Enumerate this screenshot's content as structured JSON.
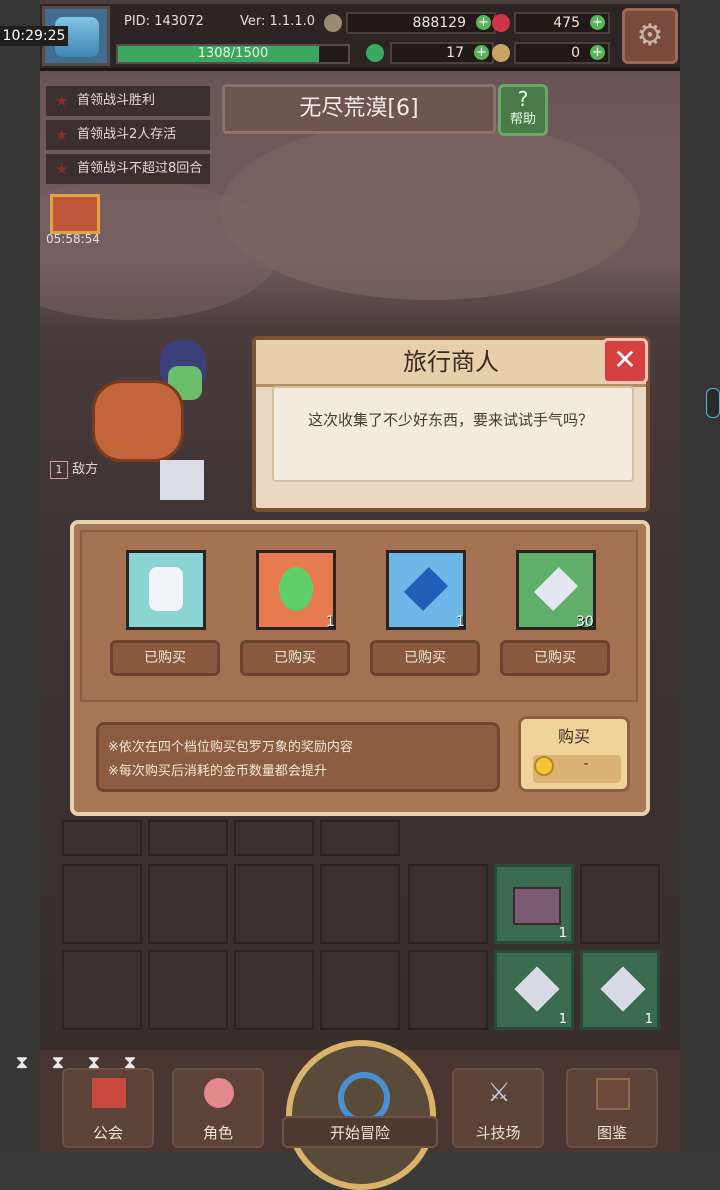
{
  "clock": "10:29:25",
  "player": {
    "pid_label": "PID: 143072",
    "version_label": "Ver: 1.1.1.0",
    "exp": "1308/1500",
    "exp_fraction": 0.872
  },
  "resources": {
    "gold": "888129",
    "gems": "475",
    "clover": "17",
    "key": "0"
  },
  "quests": [
    "首领战斗胜利",
    "首领战斗2人存活",
    "首领战斗不超过8回合"
  ],
  "stage": {
    "title": "无尽荒漠[6]",
    "help_label": "帮助"
  },
  "gift_timer": "05:58:54",
  "enemy_label": "敌方",
  "enemy_count": "1",
  "dialog": {
    "title": "旅行商人",
    "message": "这次收集了不少好东西，要来试试手气吗？"
  },
  "shop": {
    "items": [
      {
        "icon": "rabbit-icon",
        "count": "",
        "bought_label": "已购买",
        "bg": "#8ad4d4"
      },
      {
        "icon": "clover-icon",
        "count": "1",
        "bought_label": "已购买",
        "bg": "#e87a50"
      },
      {
        "icon": "blue-crystal-icon",
        "count": "1",
        "bought_label": "已购买",
        "bg": "#6db7e6"
      },
      {
        "icon": "diamond-icon",
        "count": "30",
        "bought_label": "已购买",
        "bg": "#5fae6a"
      }
    ],
    "desc_1": "※依次在四个档位购买包罗万象的奖励内容",
    "desc_2": "※每次购买后消耗的金币数量都会提升",
    "buy_label": "购买",
    "buy_price": "-"
  },
  "inventory": {
    "counts": [
      "1",
      "1",
      "1"
    ]
  },
  "nav": {
    "guild": "公会",
    "role": "角色",
    "start": "开始冒险",
    "arena": "斗技场",
    "atlas": "图鉴"
  },
  "colors": {
    "accent_gold": "#f3c63a",
    "close_red": "#d64040",
    "plus_green": "#5bb35b"
  }
}
